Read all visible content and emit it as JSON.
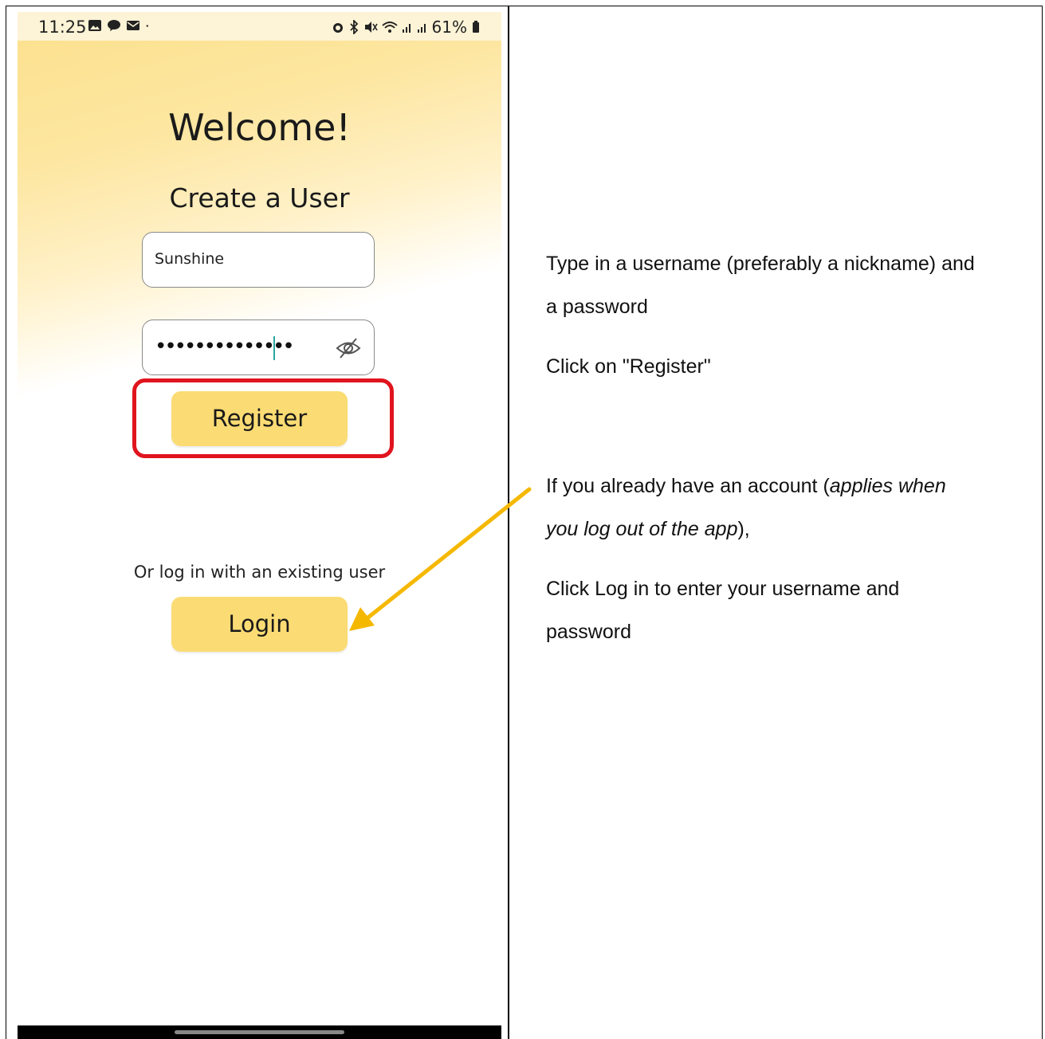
{
  "status_bar": {
    "time": "11:25",
    "left_icons": [
      "gallery-icon",
      "chat-icon",
      "mail-icon",
      "dot-icon"
    ],
    "right_icons": [
      "alarm-icon",
      "bluetooth-icon",
      "mute-icon",
      "wifi-icon",
      "signal-icon",
      "signal-icon"
    ],
    "battery": "61%"
  },
  "app": {
    "welcome": "Welcome!",
    "create_title": "Create a User",
    "username_value": "Sunshine",
    "password_value": "••••••••••••••",
    "register_label": "Register",
    "or_text": "Or log in with an existing user",
    "login_label": "Login"
  },
  "instructions": {
    "line1": "Type in a username (preferably a nickname) and",
    "line2": "a password",
    "line3": "Click on \"Register\"",
    "line4_pre": "If you already have an account (",
    "line4_em": "applies when",
    "line5_em": "you log out of the app",
    "line5_post": "),",
    "line6": "Click Log in to enter your username and",
    "line7": "password"
  },
  "colors": {
    "button": "#fbdc74",
    "highlight": "#e0141e",
    "arrow": "#f5b800"
  }
}
